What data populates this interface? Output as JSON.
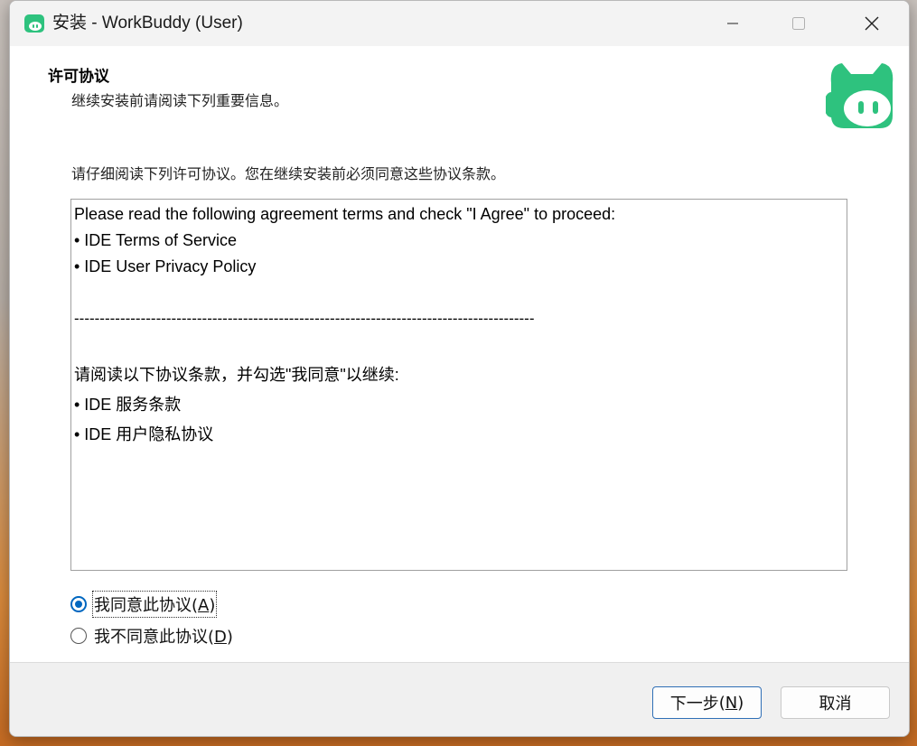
{
  "window": {
    "title": "安装 - WorkBuddy (User)"
  },
  "header": {
    "title": "许可协议",
    "subtitle": "继续安装前请阅读下列重要信息。"
  },
  "main": {
    "instruction": "请仔细阅读下列许可协议。您在继续安装前必须同意这些协议条款。",
    "license_lines": [
      "Please read the following agreement terms and check \"I Agree\" to proceed:",
      "• IDE Terms of Service",
      "• IDE User Privacy Policy",
      "",
      "------------------------------------------------------------------------------------------",
      "",
      "请阅读以下协议条款，并勾选\"我同意\"以继续:",
      "• IDE 服务条款",
      "• IDE 用户隐私协议"
    ],
    "options": [
      {
        "label": "我同意此协议",
        "accel": "A",
        "checked": true
      },
      {
        "label": "我不同意此协议",
        "accel": "D",
        "checked": false
      }
    ]
  },
  "footer": {
    "next_label": "下一步",
    "next_accel": "N",
    "cancel_label": "取消"
  },
  "colors": {
    "accent": "#0067c0",
    "logo_green": "#2ec27e"
  },
  "icons": [
    "app-icon",
    "minimize-icon",
    "maximize-icon",
    "close-icon",
    "workbuddy-logo"
  ]
}
